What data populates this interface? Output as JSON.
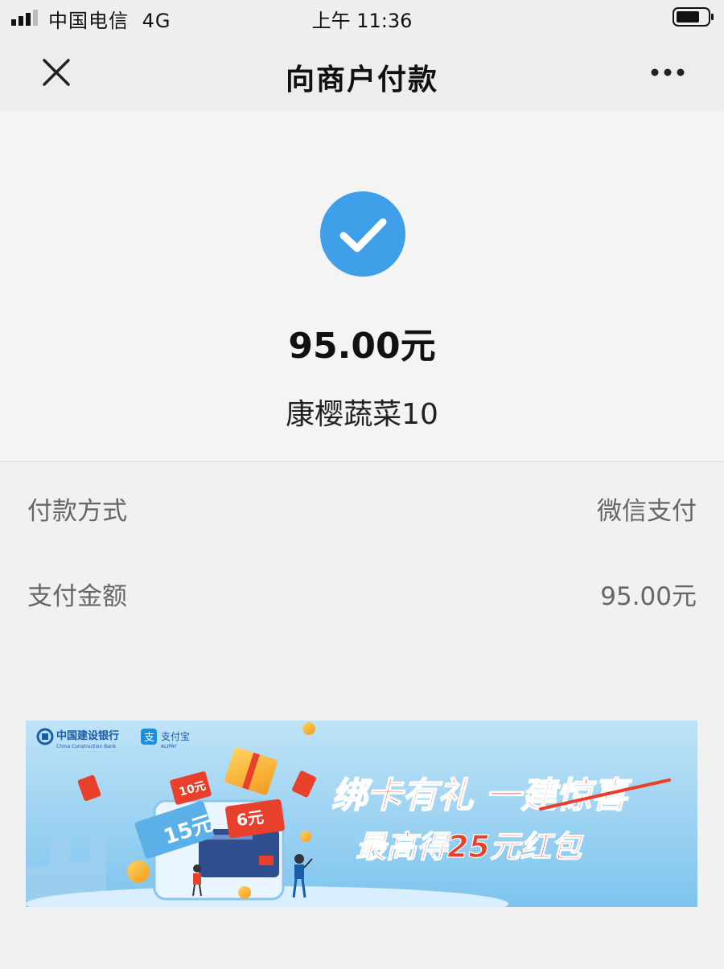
{
  "status_bar": {
    "carrier": "中国电信",
    "network": "4G",
    "time": "上午 11:36",
    "icons": [
      "signal-icon",
      "battery-icon"
    ]
  },
  "nav": {
    "title": "向商户付款",
    "close_icon": "close-icon",
    "more_icon": "more-icon"
  },
  "result": {
    "status_icon": "check-circle-icon",
    "amount": "95.00元",
    "merchant": "康樱蔬菜10"
  },
  "details": [
    {
      "label": "付款方式",
      "value": "微信支付"
    },
    {
      "label": "支付金额",
      "value": "95.00元"
    }
  ],
  "banner": {
    "bank_name": "中国建设银行",
    "bank_name_en": "China Construction Bank",
    "partner": "支付宝",
    "partner_en": "ALIPAY",
    "headline": "绑卡有礼 一建惊喜",
    "subline": "最高得25元红包",
    "coupon_15": "15元",
    "coupon_10": "10元",
    "coupon_6": "6元",
    "colors": {
      "sky": "#bfe3f7",
      "headline_red": "#e8402a",
      "accent_orange": "#f39a21"
    }
  }
}
